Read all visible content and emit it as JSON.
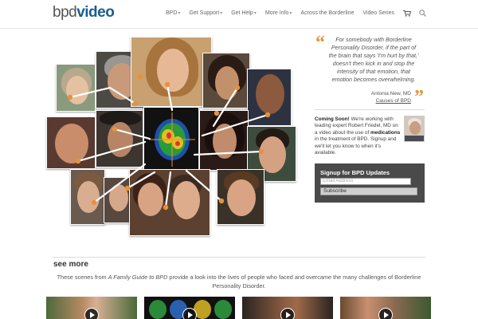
{
  "header": {
    "logo_part1": "bpd",
    "logo_part2": "video",
    "nav": [
      {
        "label": "BPD",
        "caret": "▾"
      },
      {
        "label": "Get Support",
        "caret": "▾"
      },
      {
        "label": "Get Help",
        "caret": "▾"
      },
      {
        "label": "More Info",
        "caret": "▾"
      },
      {
        "label": "Across the Borderline",
        "caret": ""
      },
      {
        "label": "Video Series",
        "caret": ""
      }
    ],
    "icons": [
      "cart-icon",
      "search-icon"
    ]
  },
  "quote": {
    "open_mark": "“",
    "close_mark": "”",
    "text": "For somebody with Borderline Personality Disorder, if the part of the brain that says 'I'm hurt by that,' doesn't then kick in and stop the intensity of that emotion, that emotion becomes overwhelming.",
    "author": "Antonia New, MD",
    "source_link": "Causes of BPD"
  },
  "coming_soon": {
    "lead": "Coming Soon!",
    "text_before": " We're working with leading expert Robert Friedel, MD on a video about the use of ",
    "bold_word": "medications",
    "text_after": " in the treatment of BPD. Signup and we'll let you know to when it's available."
  },
  "signup": {
    "title": "Signup for BPD Updates",
    "email_placeholder": "Email Address",
    "button_label": "Subscribe"
  },
  "see_more": {
    "title": "see more",
    "desc_before": "These scenes from ",
    "desc_em": "A Family Guide to BPD",
    "desc_after": " provide a look into the lives of people who faced and overcame the many challenges of Borderline Personality Disorder."
  },
  "colors": {
    "accent_orange": "#e8913a",
    "brand_blue": "#1b5d8f",
    "signup_bg": "#4a4a4a"
  }
}
